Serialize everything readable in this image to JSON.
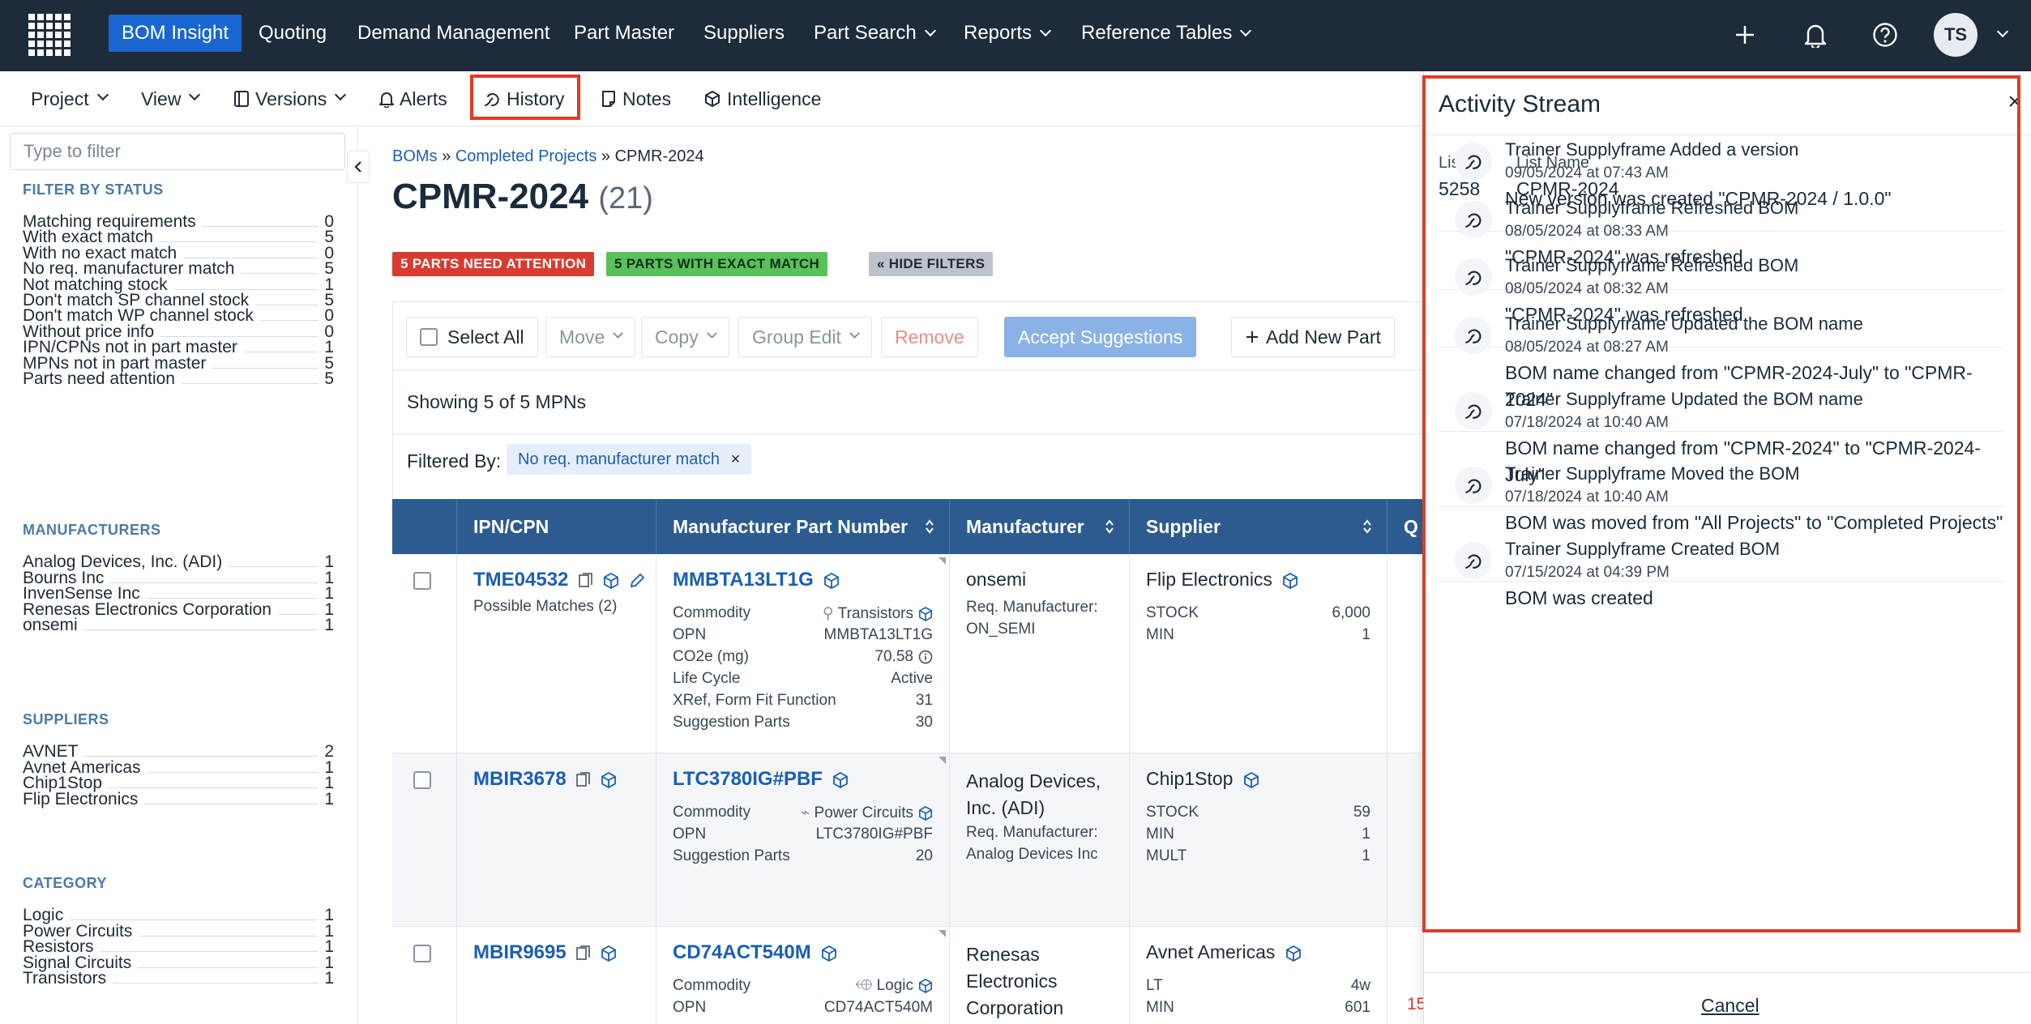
{
  "topnav": {
    "items": [
      {
        "label": "BOM Insight",
        "active": true
      },
      {
        "label": "Quoting"
      },
      {
        "label": "Demand Management"
      },
      {
        "label": "Part Master"
      },
      {
        "label": "Suppliers"
      },
      {
        "label": "Part Search",
        "dropdown": true
      },
      {
        "label": "Reports",
        "dropdown": true
      },
      {
        "label": "Reference Tables",
        "dropdown": true
      }
    ],
    "avatar_initials": "TS",
    "accent_color": "#1a66d1",
    "bg_color": "#1d2b3a"
  },
  "subbar": {
    "project": "Project",
    "view": "View",
    "versions": "Versions",
    "alerts": "Alerts",
    "history": "History",
    "notes": "Notes",
    "intelligence": "Intelligence"
  },
  "filter": {
    "placeholder": "Type to filter",
    "status_title": "FILTER BY STATUS",
    "status": [
      {
        "label": "Matching requirements",
        "count": "0"
      },
      {
        "label": "With exact match",
        "count": "5"
      },
      {
        "label": "With no exact match",
        "count": "0"
      },
      {
        "label": "No req. manufacturer match",
        "count": "5"
      },
      {
        "label": "Not matching stock",
        "count": "1"
      },
      {
        "label": "Don't match SP channel stock",
        "count": "5"
      },
      {
        "label": "Don't match WP channel stock",
        "count": "0"
      },
      {
        "label": "Without price info",
        "count": "0"
      },
      {
        "label": "IPN/CPNs not in part master",
        "count": "1"
      },
      {
        "label": "MPNs not in part master",
        "count": "5"
      },
      {
        "label": "Parts need attention",
        "count": "5"
      }
    ],
    "manufacturers_title": "MANUFACTURERS",
    "manufacturers": [
      {
        "label": "Analog Devices, Inc. (ADI)",
        "count": "1"
      },
      {
        "label": "Bourns Inc",
        "count": "1"
      },
      {
        "label": "InvenSense Inc",
        "count": "1"
      },
      {
        "label": "Renesas Electronics Corporation",
        "count": "1"
      },
      {
        "label": "onsemi",
        "count": "1"
      }
    ],
    "suppliers_title": "SUPPLIERS",
    "suppliers": [
      {
        "label": "AVNET",
        "count": "2"
      },
      {
        "label": "Avnet Americas",
        "count": "1"
      },
      {
        "label": "Chip1Stop",
        "count": "1"
      },
      {
        "label": "Flip Electronics",
        "count": "1"
      }
    ],
    "category_title": "CATEGORY",
    "categories": [
      {
        "label": "Logic",
        "count": "1"
      },
      {
        "label": "Power Circuits",
        "count": "1"
      },
      {
        "label": "Resistors",
        "count": "1"
      },
      {
        "label": "Signal Circuits",
        "count": "1"
      },
      {
        "label": "Transistors",
        "count": "1"
      }
    ]
  },
  "breadcrumb": {
    "boms": "BOMs",
    "sep": "»",
    "completed": "Completed Projects",
    "current": "CPMR-2024"
  },
  "page": {
    "title": "CPMR-2024",
    "count": "(21)"
  },
  "badges": {
    "attention": "5 PARTS NEED ATTENTION",
    "exact": "5 PARTS WITH EXACT MATCH",
    "hide": "« HIDE FILTERS"
  },
  "actions": {
    "select_all": "Select All",
    "move": "Move",
    "copy": "Copy",
    "group_edit": "Group Edit",
    "remove": "Remove",
    "accept": "Accept Suggestions",
    "add": "Add New Part"
  },
  "showing": "Showing 5 of 5 MPNs",
  "filtered": {
    "label": "Filtered By:",
    "chip": "No req. manufacturer match"
  },
  "table": {
    "headers": [
      "IPN/CPN",
      "Manufacturer Part Number",
      "Manufacturer",
      "Supplier",
      "Q"
    ],
    "rows": [
      {
        "ipn": "TME04532",
        "ipn_sub": "Possible Matches (2)",
        "mpn": "MMBTA13LT1G",
        "details": [
          {
            "k": "Commodity",
            "v": "Transistors"
          },
          {
            "k": "OPN",
            "v": "MMBTA13LT1G"
          },
          {
            "k": "CO2e (mg)",
            "v": "70.58"
          },
          {
            "k": "Life Cycle",
            "v": "Active"
          },
          {
            "k": "XRef, Form Fit Function",
            "v": "31"
          },
          {
            "k": "Suggestion Parts",
            "v": "30"
          }
        ],
        "mfr": "onsemi",
        "req_mfr": "Req. Manufacturer: ON_SEMI",
        "supplier": "Flip Electronics",
        "stock": [
          {
            "k": "STOCK",
            "v": "6,000"
          },
          {
            "k": "MIN",
            "v": "1"
          }
        ]
      },
      {
        "ipn": "MBIR3678",
        "ipn_sub": "",
        "mpn": "LTC3780IG#PBF",
        "details": [
          {
            "k": "Commodity",
            "v": "Power Circuits"
          },
          {
            "k": "OPN",
            "v": "LTC3780IG#PBF"
          },
          {
            "k": "Suggestion Parts",
            "v": "20"
          }
        ],
        "mfr": "Analog Devices, Inc. (ADI)",
        "req_mfr": "Req. Manufacturer: Analog Devices Inc",
        "supplier": "Chip1Stop",
        "stock": [
          {
            "k": "STOCK",
            "v": "59"
          },
          {
            "k": "MIN",
            "v": "1"
          },
          {
            "k": "MULT",
            "v": "1"
          }
        ]
      },
      {
        "ipn": "MBIR9695",
        "ipn_sub": "",
        "mpn": "CD74ACT540M",
        "details": [
          {
            "k": "Commodity",
            "v": "Logic"
          },
          {
            "k": "OPN",
            "v": "CD74ACT540M"
          }
        ],
        "mfr": "Renesas Electronics Corporation",
        "req_mfr": "",
        "supplier": "Avnet Americas",
        "stock": [
          {
            "k": "LT",
            "v": "4w"
          },
          {
            "k": "MIN",
            "v": "601"
          }
        ],
        "partial": "15"
      }
    ]
  },
  "activity": {
    "title": "Activity Stream",
    "list_id_label": "List ID",
    "list_id": "5258",
    "list_name_label": "List Name",
    "list_name": "CPMR-2024",
    "entries": [
      {
        "title": "Trainer Supplyframe Added a version",
        "date": "09/05/2024 at 07:43 AM",
        "desc": "New version was created \"CPMR-2024 / 1.0.0\""
      },
      {
        "title": "Trainer Supplyframe Refreshed BOM",
        "date": "08/05/2024 at 08:33 AM",
        "desc": "\"CPMR-2024\" was refreshed"
      },
      {
        "title": "Trainer Supplyframe Refreshed BOM",
        "date": "08/05/2024 at 08:32 AM",
        "desc": "\"CPMR-2024\" was refreshed"
      },
      {
        "title": "Trainer Supplyframe Updated the BOM name",
        "date": "08/05/2024 at 08:27 AM",
        "desc": "BOM name changed from \"CPMR-2024-July\" to \"CPMR-2024\""
      },
      {
        "title": "Trainer Supplyframe Updated the BOM name",
        "date": "07/18/2024 at 10:40 AM",
        "desc": "BOM name changed from \"CPMR-2024\" to \"CPMR-2024-July\""
      },
      {
        "title": "Trainer Supplyframe Moved the BOM",
        "date": "07/18/2024 at 10:40 AM",
        "desc": "BOM was moved from \"All Projects\" to \"Completed Projects\""
      },
      {
        "title": "Trainer Supplyframe Created BOM",
        "date": "07/15/2024 at 04:39 PM",
        "desc": "BOM was created"
      }
    ],
    "cancel": "Cancel"
  }
}
